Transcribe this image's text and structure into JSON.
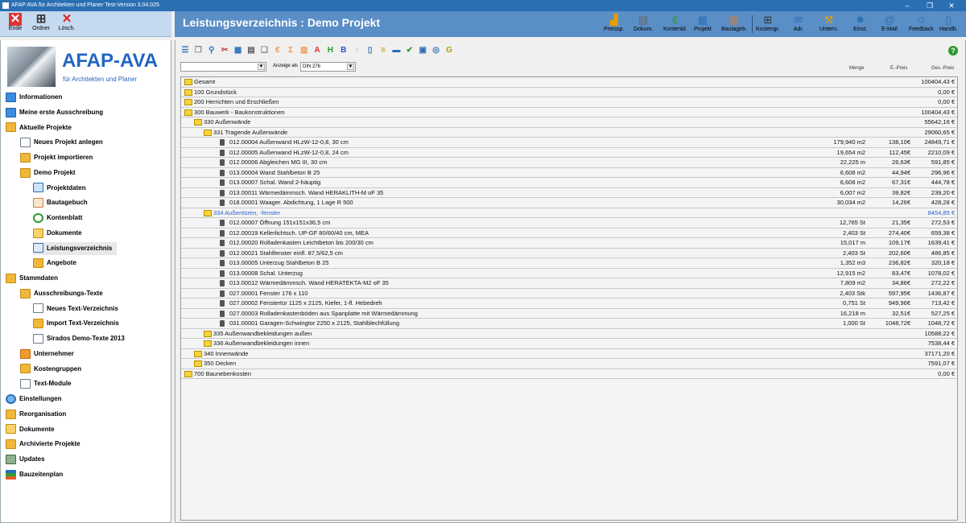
{
  "window": {
    "title": "AFAP AVA für Architekten und Planer Test-Version 3.04.025"
  },
  "left_toolbar": [
    {
      "label": "Ende",
      "icon": "close-icon"
    },
    {
      "label": "Ordner",
      "icon": "tree-icon"
    },
    {
      "label": "Lösch.",
      "icon": "delete-icon"
    }
  ],
  "header": {
    "title": "Leistungsverzeichnis : Demo Projekt"
  },
  "toolbar": [
    {
      "label": "Preissp.",
      "icon": "chart-icon",
      "color": "#e5a000"
    },
    {
      "label": "Dokum.",
      "icon": "document-icon",
      "color": "#666"
    },
    {
      "label": "Kontenbl.",
      "icon": "euro-icon",
      "color": "#2a9a2a"
    },
    {
      "label": "Projekt",
      "icon": "project-icon",
      "color": "#2a6fb6"
    },
    {
      "label": "Bautageb.",
      "icon": "book-icon",
      "color": "#d17b3f"
    },
    {
      "label": "Kostengr.",
      "icon": "tree-icon",
      "color": "#333"
    },
    {
      "label": "Adr.",
      "icon": "mail-icon",
      "color": "#2a6fb6"
    },
    {
      "label": "Untern.",
      "icon": "tools-icon",
      "color": "#e5a000"
    },
    {
      "label": "Einst.",
      "icon": "gear-icon",
      "color": "#2a6fb6"
    },
    {
      "label": "E-Mail",
      "icon": "email-icon",
      "color": "#2a6fb6"
    },
    {
      "label": "Feedback",
      "icon": "feedback-icon",
      "color": "#2a6fb6"
    },
    {
      "label": "Handb.",
      "icon": "manual-icon",
      "color": "#2a6fb6"
    }
  ],
  "sidebar": {
    "logo_title": "AFAP-AVA",
    "logo_subtitle": "für Architekten und Planer",
    "items": [
      {
        "label": "Informationen",
        "icon": "blue",
        "level": 0
      },
      {
        "label": "Meine erste Ausschreibung",
        "icon": "blue",
        "level": 0
      },
      {
        "label": "Aktuelle Projekte",
        "icon": "folder",
        "level": 0
      },
      {
        "label": "Neues Projekt anlegen",
        "icon": "doc",
        "level": 1
      },
      {
        "label": "Projekt importieren",
        "icon": "folder",
        "level": 1
      },
      {
        "label": "Demo Projekt",
        "icon": "folder",
        "level": 1
      },
      {
        "label": "Projektdaten",
        "icon": "proj",
        "level": 2
      },
      {
        "label": "Bautagebuch",
        "icon": "book",
        "level": 2
      },
      {
        "label": "Kontenblatt",
        "icon": "green",
        "level": 2
      },
      {
        "label": "Dokumente",
        "icon": "open",
        "level": 2
      },
      {
        "label": "Leistungsverzeichnis",
        "icon": "list",
        "level": 2,
        "selected": true
      },
      {
        "label": "Angebote",
        "icon": "folder",
        "level": 2
      },
      {
        "label": "Stammdaten",
        "icon": "folder",
        "level": 0
      },
      {
        "label": "Ausschreibungs-Texte",
        "icon": "folder",
        "level": 1
      },
      {
        "label": "Neues Text-Verzeichnis",
        "icon": "doc",
        "level": 2
      },
      {
        "label": "Import Text-Verzeichnis",
        "icon": "folder",
        "level": 2
      },
      {
        "label": "Sirados Demo-Texte 2013",
        "icon": "doc",
        "level": 2
      },
      {
        "label": "Unternehmer",
        "icon": "orange",
        "level": 1
      },
      {
        "label": "Kostengruppen",
        "icon": "folder",
        "level": 1
      },
      {
        "label": "Text-Module",
        "icon": "doc",
        "level": 1
      },
      {
        "label": "Einstellungen",
        "icon": "gear",
        "level": 0
      },
      {
        "label": "Reorganisation",
        "icon": "folder",
        "level": 0
      },
      {
        "label": "Dokumente",
        "icon": "open",
        "level": 0
      },
      {
        "label": "Archivierte Projekte",
        "icon": "folder",
        "level": 0
      },
      {
        "label": "Updates",
        "icon": "upd",
        "level": 0
      },
      {
        "label": "Bauzeitenplan",
        "icon": "gantt",
        "level": 0
      }
    ]
  },
  "lv_toolbar": {
    "icons": [
      {
        "name": "list-icon",
        "glyph": "☰",
        "color": "#2a6fb6"
      },
      {
        "name": "copy-icon",
        "glyph": "❐",
        "color": "#888"
      },
      {
        "name": "search-icon",
        "glyph": "⚲",
        "color": "#2a6fb6"
      },
      {
        "name": "cut-icon",
        "glyph": "✂",
        "color": "#cc3333"
      },
      {
        "name": "book-icon",
        "glyph": "▦",
        "color": "#2a6fb6"
      },
      {
        "name": "calc-icon",
        "glyph": "▤",
        "color": "#5a5a5a"
      },
      {
        "name": "paste-icon",
        "glyph": "❏",
        "color": "#888"
      },
      {
        "name": "euro-icon",
        "glyph": "€",
        "color": "#ee9955"
      },
      {
        "name": "sum-icon",
        "glyph": "Σ",
        "color": "#ee9955"
      },
      {
        "name": "table-icon",
        "glyph": "▥",
        "color": "#ee9955"
      },
      {
        "name": "font-icon",
        "glyph": "A",
        "color": "#dd3333"
      },
      {
        "name": "heading-icon",
        "glyph": "H",
        "color": "#2a9a2a"
      },
      {
        "name": "bold-icon",
        "glyph": "B",
        "color": "#2a4fd0"
      },
      {
        "name": "mark-icon",
        "glyph": "▫",
        "color": "#e59a9a"
      },
      {
        "name": "page-icon",
        "glyph": "▯",
        "color": "#2a6fb6"
      },
      {
        "name": "note-icon",
        "glyph": "≡",
        "color": "#a0a000"
      },
      {
        "name": "print-icon",
        "glyph": "▬",
        "color": "#2a6fb6"
      },
      {
        "name": "check-icon",
        "glyph": "✔",
        "color": "#2a9a2a"
      },
      {
        "name": "save-icon",
        "glyph": "▣",
        "color": "#2a6fb6"
      },
      {
        "name": "world-icon",
        "glyph": "◎",
        "color": "#2a6fb6"
      },
      {
        "name": "g-icon",
        "glyph": "G",
        "color": "#b0a000"
      }
    ],
    "filter_value": "",
    "anzeige_label": "Anzeige als",
    "anzeige_value": "DIN 276",
    "col_menge": "Menge",
    "col_epreis": "E.-Preis",
    "col_gpreis": "Ges.-Preis"
  },
  "rows": [
    {
      "type": "folder",
      "level": 0,
      "label": "Gesamt",
      "menge": "",
      "ep": "",
      "gp": "100404,43 €"
    },
    {
      "type": "folder",
      "level": 0,
      "label": "100 Grundstück",
      "menge": "",
      "ep": "",
      "gp": "0,00 €"
    },
    {
      "type": "folder",
      "level": 0,
      "label": "200 Herrichten und Erschließen",
      "menge": "",
      "ep": "",
      "gp": "0,00 €"
    },
    {
      "type": "folder",
      "level": 0,
      "label": "300 Bauwerk - Baukonstruktionen",
      "menge": "",
      "ep": "",
      "gp": "100404,43 €"
    },
    {
      "type": "folder",
      "level": 1,
      "label": "330 Außenwände",
      "menge": "",
      "ep": "",
      "gp": "55642,16 €"
    },
    {
      "type": "folder",
      "level": 2,
      "label": "331 Tragende Außenwände",
      "menge": "",
      "ep": "",
      "gp": "29060,65 €"
    },
    {
      "type": "pos",
      "level": 3,
      "label": "012.00004 Außenwand HLzW-12-0,8, 30 cm",
      "menge": "179,940 m2",
      "ep": "138,10€",
      "gp": "24849,71 €"
    },
    {
      "type": "pos",
      "level": 3,
      "label": "012.00005 Außenwand HLzW-12-0,8, 24 cm",
      "menge": "19,654 m2",
      "ep": "112,45€",
      "gp": "2210,09 €"
    },
    {
      "type": "pos",
      "level": 3,
      "label": "012.00006 Abgleichen MG III, 30 cm",
      "menge": "22,225 m",
      "ep": "26,63€",
      "gp": "591,85 €"
    },
    {
      "type": "pos",
      "level": 3,
      "label": "013.00004 Wand Stahlbeton B 25",
      "menge": "6,608 m2",
      "ep": "44,94€",
      "gp": "296,96 €"
    },
    {
      "type": "pos",
      "level": 3,
      "label": "013.00007 Schal. Wand 2-häuptig",
      "menge": "6,608 m2",
      "ep": "67,31€",
      "gp": "444,78 €"
    },
    {
      "type": "pos",
      "level": 3,
      "label": "013.00011 Wärmedämmsch. Wand HERAKLITH-M oF 35",
      "menge": "6,007 m2",
      "ep": "39,82€",
      "gp": "239,20 €"
    },
    {
      "type": "pos",
      "level": 3,
      "label": "018.00001 Waager. Abdichtung, 1 Lage R 500",
      "menge": "30,034 m2",
      "ep": "14,26€",
      "gp": "428,28 €"
    },
    {
      "type": "folder",
      "level": 2,
      "label": "334 Außentüren, -fenster",
      "menge": "",
      "ep": "",
      "gp": "8454,85 €",
      "highlight": true
    },
    {
      "type": "pos",
      "level": 3,
      "label": "012.00007 Öffnung 151x151x36,5 cm",
      "menge": "12,765 St",
      "ep": "21,35€",
      "gp": "272,53 €"
    },
    {
      "type": "pos",
      "level": 3,
      "label": "012.00019 Kellerlichtsch. UP-GF 80/60/40 cm, MEA",
      "menge": "2,403 St",
      "ep": "274,40€",
      "gp": "659,38 €"
    },
    {
      "type": "pos",
      "level": 3,
      "label": "012.00020 Rolladenkasten Leichtbeton bis 200/30 cm",
      "menge": "15,017 m",
      "ep": "109,17€",
      "gp": "1639,41 €"
    },
    {
      "type": "pos",
      "level": 3,
      "label": "012.00021 Stahlfenster einfl. 87,5/62,5 cm",
      "menge": "2,403 St",
      "ep": "202,60€",
      "gp": "486,85 €"
    },
    {
      "type": "pos",
      "level": 3,
      "label": "013.00005 Unterzug Stahlbeton B 25",
      "menge": "1,352 m3",
      "ep": "236,82€",
      "gp": "320,18 €"
    },
    {
      "type": "pos",
      "level": 3,
      "label": "013.00008 Schal. Unterzug",
      "menge": "12,915 m2",
      "ep": "83,47€",
      "gp": "1078,02 €"
    },
    {
      "type": "pos",
      "level": 3,
      "label": "013.00012 Wärmedämmsch. Wand HERATEKTA-M2 oF 35",
      "menge": "7,809 m2",
      "ep": "34,86€",
      "gp": "272,22 €"
    },
    {
      "type": "pos",
      "level": 3,
      "label": "027.00001 Fenster 176 x 110",
      "menge": "2,403 Stk",
      "ep": "597,95€",
      "gp": "1436,87 €"
    },
    {
      "type": "pos",
      "level": 3,
      "label": "027.00002 Fenstertür 1125 x 2125, Kiefer, 1-fl. Hebedreh",
      "menge": "0,751 St",
      "ep": "949,96€",
      "gp": "713,42 €"
    },
    {
      "type": "pos",
      "level": 3,
      "label": "027.00003 Rolladenkastenböden aus Spanplatte mit Wärmedämmung",
      "menge": "16,218 m",
      "ep": "32,51€",
      "gp": "527,25 €"
    },
    {
      "type": "pos",
      "level": 3,
      "label": "031.00001 Garagen-Schwingtor 2250 x 2125, Stahlblechfüllung",
      "menge": "1,000 St",
      "ep": "1048,72€",
      "gp": "1048,72 €"
    },
    {
      "type": "folder",
      "level": 2,
      "label": "335 Außenwandbekleidungen außen",
      "menge": "",
      "ep": "",
      "gp": "10588,22 €"
    },
    {
      "type": "folder",
      "level": 2,
      "label": "336 Außenwandbekleidungen innen",
      "menge": "",
      "ep": "",
      "gp": "7538,44 €"
    },
    {
      "type": "folder",
      "level": 1,
      "label": "340 Innenwände",
      "menge": "",
      "ep": "",
      "gp": "37171,20 €"
    },
    {
      "type": "folder",
      "level": 1,
      "label": "350 Decken",
      "menge": "",
      "ep": "",
      "gp": "7591,07 €"
    },
    {
      "type": "folder",
      "level": 0,
      "label": "700 Baunebenkosten",
      "menge": "",
      "ep": "",
      "gp": "0,00 €"
    }
  ]
}
